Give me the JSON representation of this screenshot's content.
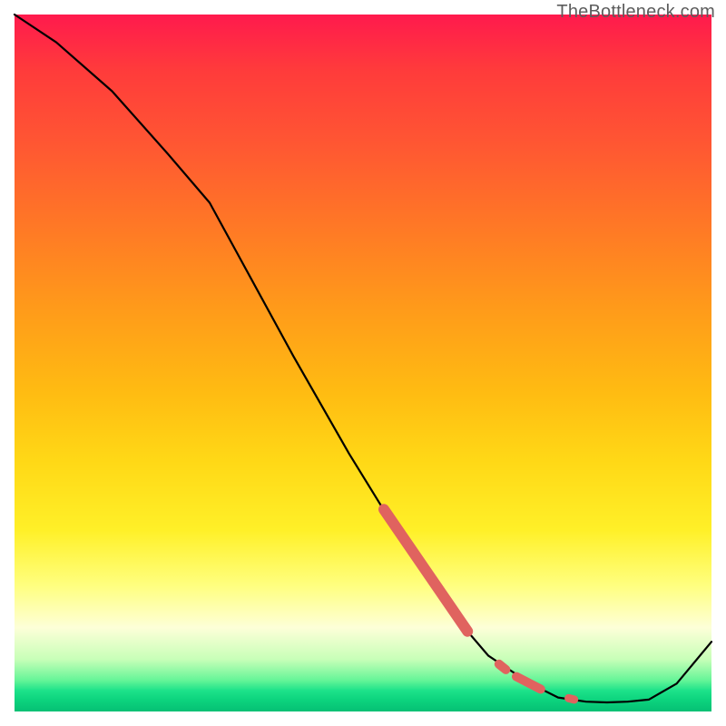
{
  "watermark": "TheBottleneck.com",
  "chart_data": {
    "type": "line",
    "title": "",
    "xlabel": "",
    "ylabel": "",
    "xlim": [
      0,
      100
    ],
    "ylim": [
      0,
      100
    ],
    "series": [
      {
        "name": "curve",
        "x": [
          0,
          6,
          14,
          22,
          28,
          34,
          40,
          48,
          56,
          62,
          68,
          74,
          78,
          82,
          85,
          88,
          91,
          95,
          100
        ],
        "y": [
          100,
          96,
          89,
          80,
          73,
          62,
          51,
          37,
          24,
          15,
          8,
          4,
          2,
          1.4,
          1.3,
          1.4,
          1.7,
          4,
          10
        ]
      }
    ],
    "markers": [
      {
        "x0": 53,
        "y0": 29,
        "x1": 65,
        "y1": 11.5,
        "w": 12
      },
      {
        "x0": 69.5,
        "y0": 6.8,
        "x1": 70.5,
        "y1": 6.0,
        "w": 10
      },
      {
        "x0": 72,
        "y0": 5.0,
        "x1": 75.5,
        "y1": 3.2,
        "w": 10
      },
      {
        "x0": 79.5,
        "y0": 1.9,
        "x1": 80.3,
        "y1": 1.7,
        "w": 9
      }
    ],
    "marker_color": "#e0635f",
    "background_gradient": [
      {
        "stop": 0.0,
        "color": "#ff1a4d"
      },
      {
        "stop": 0.5,
        "color": "#ffd816"
      },
      {
        "stop": 0.88,
        "color": "#fdffd8"
      },
      {
        "stop": 1.0,
        "color": "#05c074"
      }
    ]
  }
}
